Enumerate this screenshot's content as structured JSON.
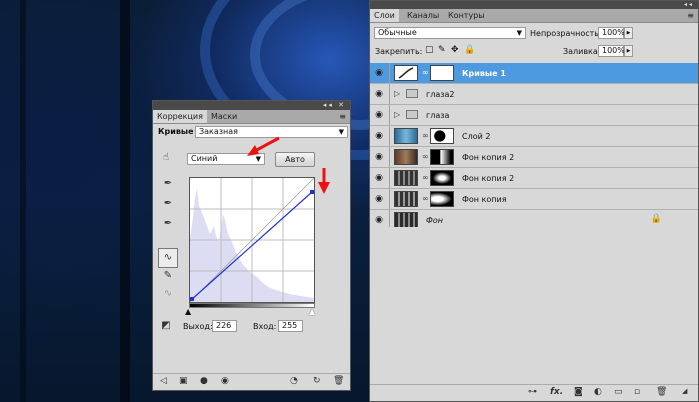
{
  "adjustments_panel": {
    "tabs": [
      "Коррекция",
      "Маски"
    ],
    "title": "Кривые",
    "preset_value": "Заказная",
    "channel_value": "Синий",
    "auto_label": "Авто",
    "output_label": "Выход:",
    "output_value": "226",
    "input_label": "Вход:",
    "input_value": "255"
  },
  "layers_panel": {
    "tabs": [
      "Слои",
      "Каналы",
      "Контуры"
    ],
    "blend_mode": "Обычные",
    "opacity_label": "Непрозрачность:",
    "opacity_value": "100%",
    "lock_label": "Закрепить:",
    "fill_label": "Заливка:",
    "fill_value": "100%",
    "layers": [
      {
        "name": "Кривые 1",
        "selected": true,
        "kind": "adjustment"
      },
      {
        "name": "глаза2",
        "kind": "group"
      },
      {
        "name": "глаза",
        "kind": "group"
      },
      {
        "name": "Слой 2",
        "kind": "masked"
      },
      {
        "name": "Фон копия 2",
        "kind": "masked"
      },
      {
        "name": "Фон копия 2",
        "kind": "masked"
      },
      {
        "name": "Фон копия",
        "kind": "masked"
      },
      {
        "name": "Фон",
        "kind": "background",
        "locked": true
      }
    ]
  },
  "curve": {
    "channel_color": "#2233cc",
    "highlight_input": 255,
    "highlight_output": 226
  },
  "colors": {
    "selection": "#4e9ae0",
    "panel_bg": "#d8d8d8",
    "annotation_arrow": "#ee1111"
  }
}
